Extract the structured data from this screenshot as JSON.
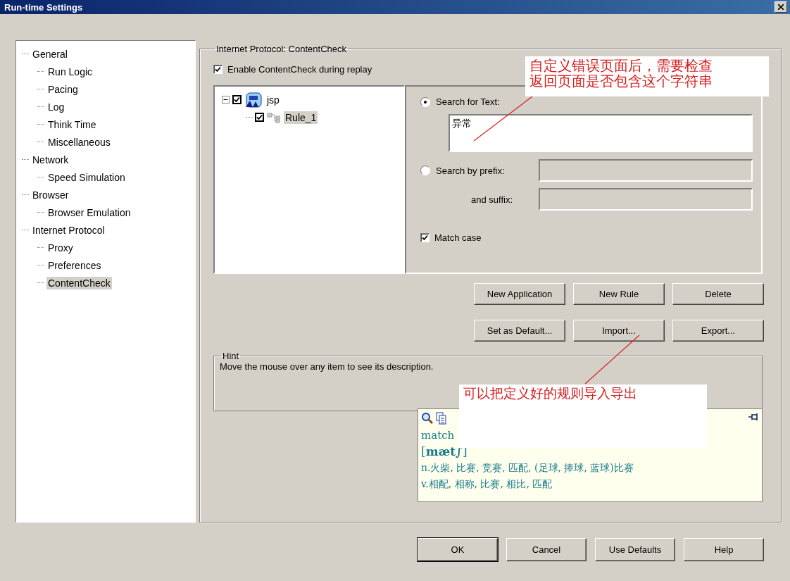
{
  "window": {
    "title": "Run-time Settings"
  },
  "sidebar": {
    "items": [
      {
        "label": "General",
        "selected": false,
        "children": [
          {
            "label": "Run Logic",
            "selected": false
          },
          {
            "label": "Pacing",
            "selected": false
          },
          {
            "label": "Log",
            "selected": false
          },
          {
            "label": "Think Time",
            "selected": false
          },
          {
            "label": "Miscellaneous",
            "selected": false
          }
        ]
      },
      {
        "label": "Network",
        "selected": false,
        "children": [
          {
            "label": "Speed Simulation",
            "selected": false
          }
        ]
      },
      {
        "label": "Browser",
        "selected": false,
        "children": [
          {
            "label": "Browser Emulation",
            "selected": false
          }
        ]
      },
      {
        "label": "Internet Protocol",
        "selected": false,
        "children": [
          {
            "label": "Proxy",
            "selected": false
          },
          {
            "label": "Preferences",
            "selected": false
          },
          {
            "label": "ContentCheck",
            "selected": true
          }
        ]
      }
    ]
  },
  "panel": {
    "title": "Internet Protocol: ContentCheck",
    "enable": {
      "label": "Enable ContentCheck during replay",
      "checked": true
    },
    "rules_tree": [
      {
        "label": "jsp",
        "checked": true,
        "expanded": true,
        "selected": false,
        "children": [
          {
            "label": "Rule_1",
            "checked": true,
            "selected": true
          }
        ]
      }
    ],
    "search_text": {
      "label": "Search for Text:",
      "selected": true,
      "value": "异常"
    },
    "search_prefix": {
      "label": "Search by prefix:",
      "selected": false,
      "suffix_label": "and suffix:"
    },
    "match_case": {
      "label": "Match case",
      "checked": true
    },
    "action_buttons": [
      "New Application",
      "New Rule",
      "Delete",
      "Set as Default...",
      "Import...",
      "Export..."
    ],
    "hint": {
      "title": "Hint",
      "text": "Move the mouse over any item to see its description."
    }
  },
  "dictionary_popup": {
    "word": "match",
    "phonetic": "[**mæt∫**]",
    "definitions": [
      "n.火柴, 比赛, 竞赛, 匹配, (足球, 捧球, 蓝球)比赛",
      "v.相配, 相称, 比赛, 相比, 匹配"
    ]
  },
  "annotations": [
    {
      "lines": [
        "自定义错误页面后，需要检查",
        "返回页面是否包含这个字符串"
      ]
    },
    {
      "lines": [
        "可以把定义好的规则导入导出"
      ]
    }
  ],
  "buttons": [
    {
      "label": "OK",
      "default": true
    },
    {
      "label": "Cancel",
      "default": false
    },
    {
      "label": "Use Defaults",
      "default": false
    },
    {
      "label": "Help",
      "default": false
    }
  ]
}
